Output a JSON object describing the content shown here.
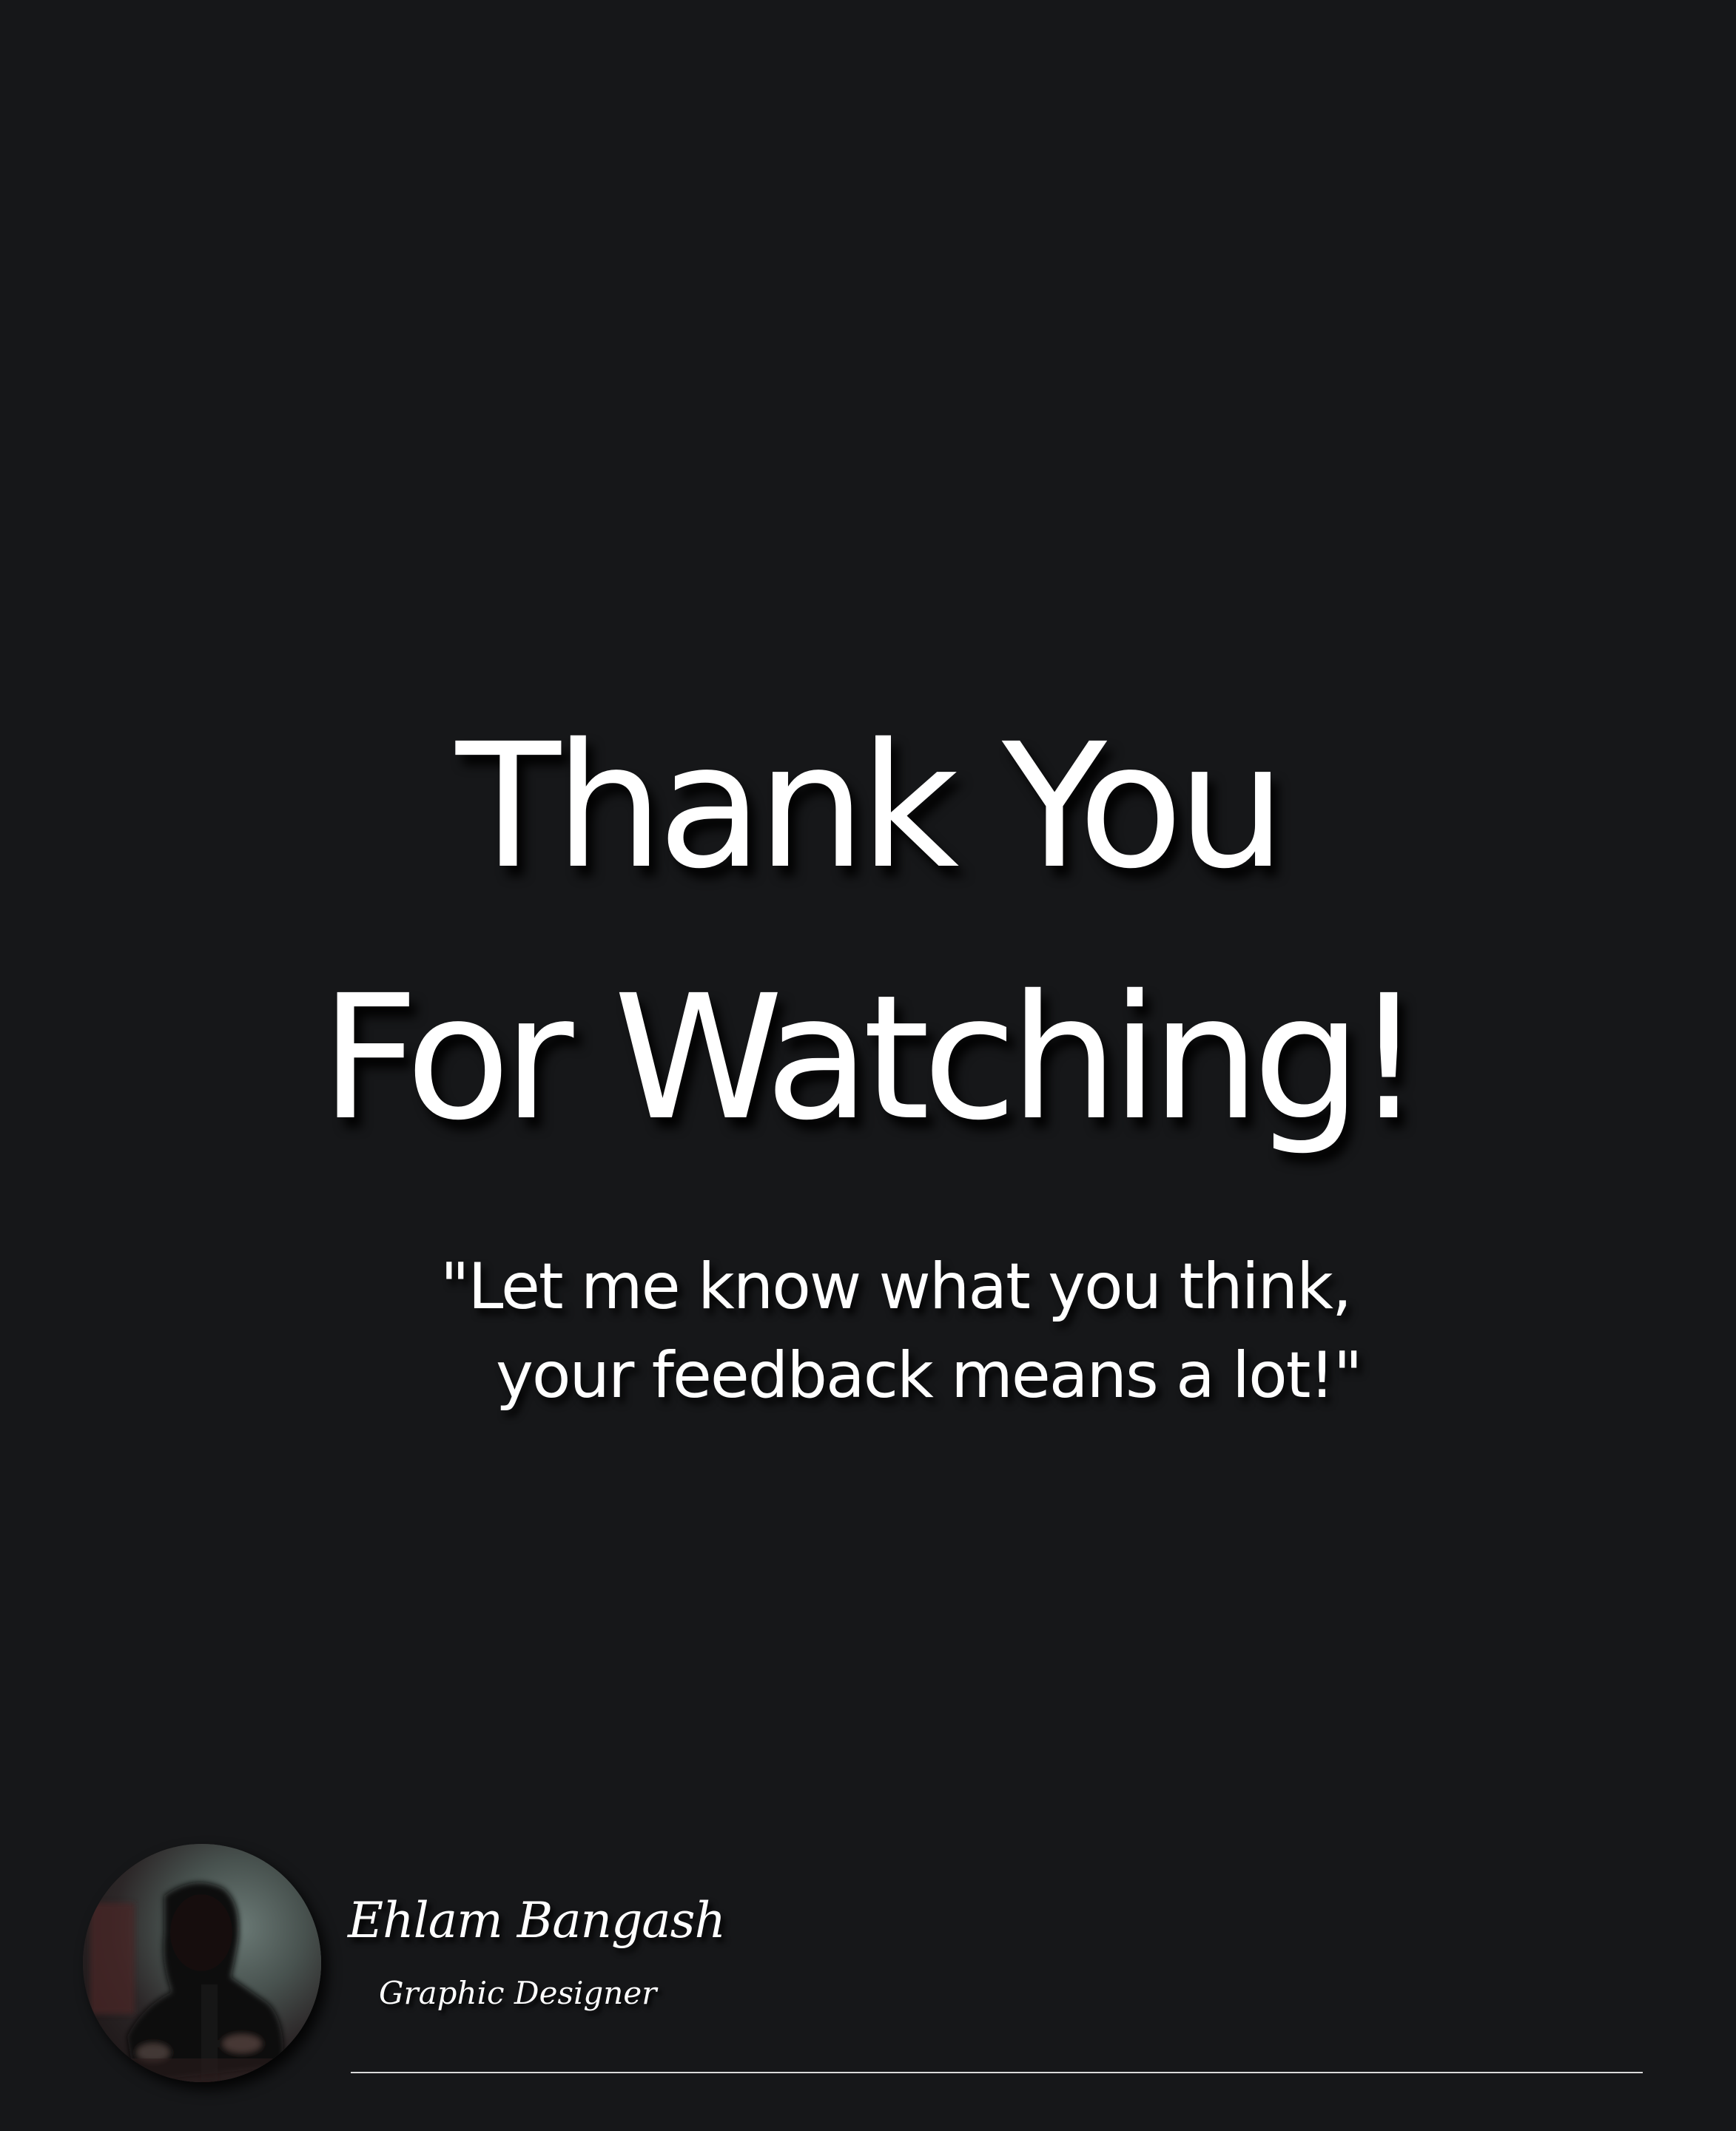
{
  "slide": {
    "headline_line1": "Thank You",
    "headline_line2": "For Watching!",
    "quote_line1": "\"Let me know what you think,",
    "quote_line2": "your feedback means a lot!\"",
    "background_color": "#161719",
    "text_color": "#ffffff"
  },
  "author": {
    "name": "Ehlam Bangash",
    "role": "Graphic Designer",
    "avatar_icon": "profile-photo"
  }
}
